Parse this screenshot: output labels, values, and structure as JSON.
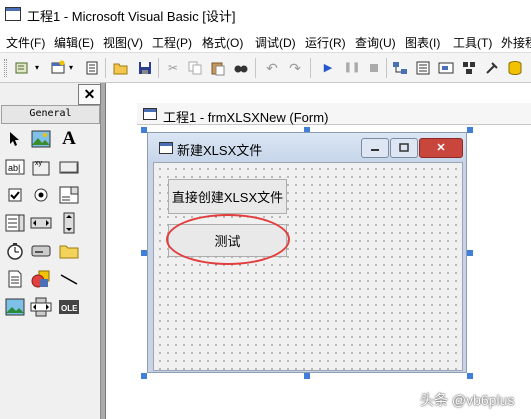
{
  "window": {
    "title": "工程1 - Microsoft Visual Basic [设计]"
  },
  "menu": [
    "文件(F)",
    "编辑(E)",
    "视图(V)",
    "工程(P)",
    "格式(O)",
    "调试(D)",
    "运行(R)",
    "查询(U)",
    "图表(I)",
    "工具(T)",
    "外接程"
  ],
  "toolbar": {
    "icons": [
      "add-project-icon",
      "add-form-icon",
      "menu-editor-icon",
      "open-icon",
      "save-icon",
      "cut-icon",
      "copy-icon",
      "paste-icon",
      "find-icon",
      "undo-icon",
      "redo-icon",
      "start-icon",
      "break-icon",
      "end-icon",
      "project-explorer-icon",
      "properties-icon",
      "form-layout-icon",
      "object-browser-icon",
      "toolbox-icon",
      "data-view-icon"
    ]
  },
  "toolbox": {
    "tab": "General",
    "tools": [
      "pointer",
      "picturebox",
      "label",
      "textbox",
      "frame",
      "commandbutton",
      "checkbox",
      "optionbutton",
      "combobox",
      "listbox",
      "hscrollbar",
      "vscrollbar",
      "timer",
      "drivelistbox",
      "dirlistbox",
      "filelistbox",
      "shape",
      "line",
      "image",
      "data",
      "ole"
    ]
  },
  "designer": {
    "title": "工程1 - frmXLSXNew (Form)"
  },
  "form": {
    "caption": "新建XLSX文件",
    "buttons": {
      "create": "直接创建XLSX文件",
      "test": "测试"
    }
  },
  "watermark": "头条 @vb6plus"
}
